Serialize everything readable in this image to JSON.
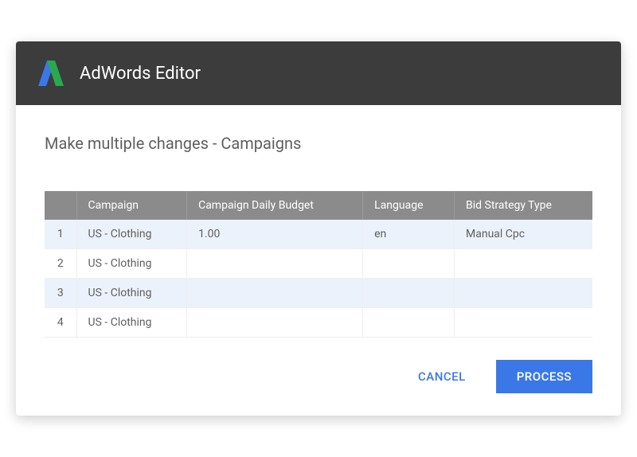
{
  "header": {
    "app_title": "AdWords Editor"
  },
  "page": {
    "title": "Make multiple changes - Campaigns"
  },
  "table": {
    "columns": {
      "c0": "",
      "c1": "Campaign",
      "c2": "Campaign Daily Budget",
      "c3": "Language",
      "c4": "Bid Strategy Type"
    },
    "rows": [
      {
        "idx": "1",
        "campaign": "US - Clothing",
        "budget": "1.00",
        "language": "en",
        "bid": "Manual Cpc"
      },
      {
        "idx": "2",
        "campaign": "US - Clothing",
        "budget": "",
        "language": "",
        "bid": ""
      },
      {
        "idx": "3",
        "campaign": "US - Clothing",
        "budget": "",
        "language": "",
        "bid": ""
      },
      {
        "idx": "4",
        "campaign": "US - Clothing",
        "budget": "",
        "language": "",
        "bid": ""
      }
    ]
  },
  "actions": {
    "cancel": "CANCEL",
    "process": "PROCESS"
  }
}
